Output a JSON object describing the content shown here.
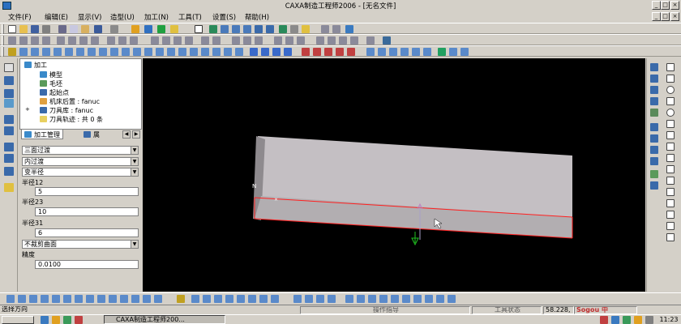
{
  "window": {
    "title": "CAXA制造工程师2006 - [无名文件]"
  },
  "menu": [
    "文件(F)",
    "编辑(E)",
    "显示(V)",
    "造型(U)",
    "加工(N)",
    "工具(T)",
    "设置(S)",
    "帮助(H)"
  ],
  "tree": {
    "root": "加工",
    "nodes": [
      "模型",
      "毛坯",
      "起始点",
      "机床后置 : fanuc",
      "刀具库 : fanuc",
      "刀具轨迹 : 共 0 条"
    ],
    "expand_toggle": "+"
  },
  "tabs": [
    "加工管理",
    "属"
  ],
  "params": {
    "combo1": "三面过渡",
    "combo2": "内过渡",
    "combo3": "变半径",
    "label_r12": "半径12",
    "value_r12": "5",
    "label_r23": "半径23",
    "value_r23": "10",
    "label_r31": "半径31",
    "value_r31": "6",
    "combo4": "不裁剪曲面",
    "label_precision": "精度",
    "value_precision": "0.0100"
  },
  "viewport": {
    "axis_label": "N"
  },
  "status": {
    "prompt": "选择方向",
    "center": "操作指导",
    "right": "工具状态",
    "coords": "58.228,"
  },
  "taskbar": {
    "task": "CAXA制造工程师200...",
    "clock": "11:23",
    "ime": "Sogou 中"
  },
  "colors": {
    "viewport_bg": "#000000",
    "face": "#bab6b9",
    "edge_highlight": "#ff2020",
    "ui_face": "#d4d0c8"
  }
}
